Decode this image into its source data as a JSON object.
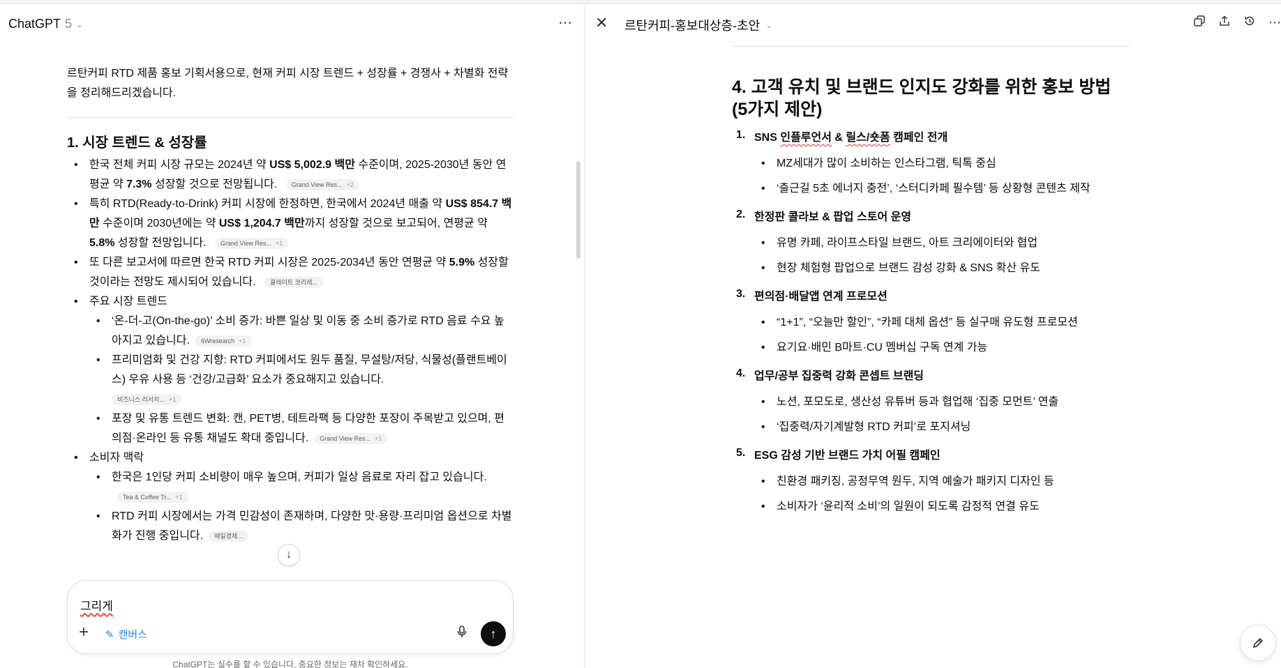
{
  "left": {
    "model_name": "ChatGPT",
    "model_version": "5",
    "intro": "르탄커피 RTD 제품 홍보 기획서용으로, 현재 커피 시장 트렌드 + 성장률 + 경쟁사 + 차별화 전략을 정리해드리겠습니다.",
    "section_title": "1. 시장 트렌드 & 성장률",
    "bullets": {
      "b1_pre": "한국 전체 커피 시장 규모는 2024년 약 ",
      "b1_bold1": "US$ 5,002.9 백만",
      "b1_mid": " 수준이며, 2025-2030년 동안 연평균 약 ",
      "b1_bold2": "7.3%",
      "b1_post": " 성장할 것으로 전망됩니다.",
      "b1_cite": "Grand View Res...",
      "b1_cite_plus": "+2",
      "b2_pre": "특히 RTD(Ready-to-Drink) 커피 시장에 한정하면, 한국에서 2024년 매출 약 ",
      "b2_bold1": "US$ 854.7 백만",
      "b2_mid": " 수준이며 2030년에는 약 ",
      "b2_bold2": "US$ 1,204.7 백만",
      "b2_mid2": "까지 성장할 것으로 보고되어, 연평균 약 ",
      "b2_bold3": "5.8%",
      "b2_post": " 성장할 전망입니다.",
      "b2_cite": "Grand View Res...",
      "b2_cite_plus": "+1",
      "b3_pre": "또 다른 보고서에 따르면 한국 RTD 커피 시장은 2025-2034년 동안 연평균 약 ",
      "b3_bold": "5.9%",
      "b3_post": " 성장할 것이라는 전망도 제시되어 있습니다.",
      "b3_cite": "클레이트 코리레...",
      "b4": "주요 시장 트렌드",
      "b4_1": "‘온-더-고(On-the-go)’ 소비 증가: 바쁜 일상 및 이동 중 소비 증가로 RTD 음료 수요 높아지고 있습니다.",
      "b4_1_cite": "6Wresearch",
      "b4_1_cite_plus": "+1",
      "b4_2": "프리미엄화 및 건강 지향: RTD 커피에서도 원두 품질, 무설탕/저당, 식물성(플랜트베이스) 우유 사용 등 ‘건강/고급화’ 요소가 중요해지고 있습니다.",
      "b4_2_cite": "비즈니스 리서치...",
      "b4_2_cite_plus": "+1",
      "b4_3": "포장 및 유통 트렌드 변화: 캔, PET병, 테트라팩 등 다양한 포장이 주목받고 있으며, 편의점·온라인 등 유통 채널도 확대 중입니다.",
      "b4_3_cite": "Grand View Res...",
      "b4_3_cite_plus": "+1",
      "b5": "소비자 맥락",
      "b5_1": "한국은 1인당 커피 소비량이 매우 높으며, 커피가 일상 음료로 자리 잡고 있습니다.",
      "b5_1_cite": "Tea & Coffee Tr...",
      "b5_1_cite_plus": "+1",
      "b5_2": "RTD 커피 시장에서는 가격 민감성이 존재하며, 다양한 맛·용량·프리미엄 옵션으로 차별화가 진행 중입니다.",
      "b5_2_cite": "매일경제..."
    },
    "composer": {
      "text": "그리게",
      "canvas_label": "캔버스"
    },
    "disclaimer": "ChatGPT는 실수를 할 수 있습니다. 중요한 정보는 재차 확인하세요."
  },
  "right": {
    "doc_title": "르탄커피-홍보대상층-초안",
    "heading": "4. 고객 유치 및 브랜드 인지도 강화를 위한 홍보 방법 (5가지 제안)",
    "items": [
      {
        "num": "1.",
        "title_pre": "SNS ",
        "title_sq1": "인플루언서",
        "title_mid": " & ",
        "title_sq2": "릴스/숏폼",
        "title_post": " 캠페인 전개",
        "subs": [
          "MZ세대가 많이 소비하는 인스타그램, 틱톡 중심",
          "‘출근길 5초 에너지 충전’, ‘스터디카페 필수템’ 등 상황형 콘텐츠 제작"
        ]
      },
      {
        "num": "2.",
        "title": "한정판 콜라보 & 팝업 스토어 운영",
        "subs": [
          "유명 카페, 라이프스타일 브랜드, 아트 크리에이터와 협업",
          "현장 체험형 팝업으로 브랜드 감성 강화 & SNS 확산 유도"
        ]
      },
      {
        "num": "3.",
        "title": "편의점·배달앱 연계 프로모션",
        "subs": [
          "“1+1”, “오늘만 할인”, “카페 대체 옵션” 등 실구매 유도형 프로모션",
          "요기요·배민 B마트·CU 멤버십 구독 연계 가능"
        ]
      },
      {
        "num": "4.",
        "title": "업무/공부 집중력 강화 콘셉트 브랜딩",
        "subs": [
          "노션, 포모도로, 생산성 유튜버 등과 협업해 ‘집중 모먼트’ 연출",
          "‘집중력/자기계발형 RTD 커피’로 포지셔닝"
        ]
      },
      {
        "num": "5.",
        "title": "ESG 감성 기반 브랜드 가치 어필 캠페인",
        "subs": [
          "친환경 패키징, 공정무역 원두, 지역 예술가 패키지 디자인 등",
          "소비자가 ‘윤리적 소비’의 일원이 되도록 감정적 연결 유도"
        ]
      }
    ]
  },
  "icons": [
    "chevron-down-icon",
    "more-icon",
    "close-icon",
    "copy-icon",
    "share-icon",
    "history-icon",
    "plus-icon",
    "canvas-icon",
    "mic-icon",
    "send-icon",
    "arrow-down-icon",
    "edit-icon"
  ]
}
